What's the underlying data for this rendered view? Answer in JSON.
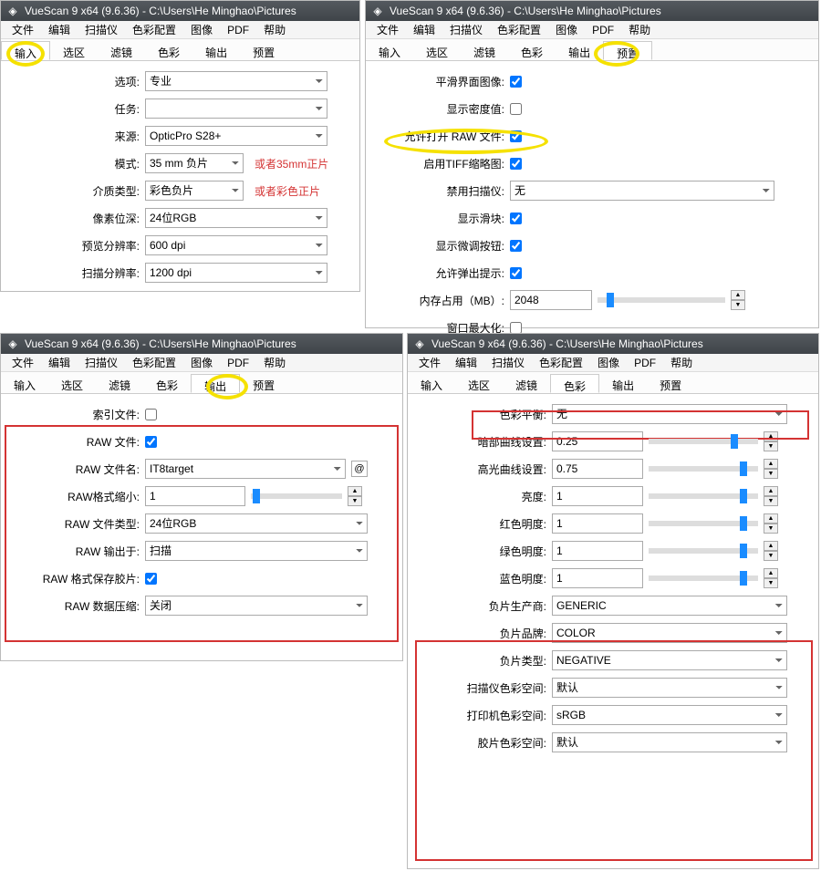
{
  "app": {
    "icon": "◈",
    "title": "VueScan 9 x64 (9.6.36) - C:\\Users\\He Minghao\\Pictures"
  },
  "menubar": [
    "文件",
    "编辑",
    "扫描仪",
    "色彩配置",
    "图像",
    "PDF",
    "帮助"
  ],
  "tabs": [
    "输入",
    "选区",
    "滤镜",
    "色彩",
    "输出",
    "预置"
  ],
  "panel1": {
    "options_lbl": "选项:",
    "options_val": "专业",
    "task_lbl": "任务:",
    "task_val": "",
    "source_lbl": "来源:",
    "source_val": "OpticPro S28+",
    "mode_lbl": "模式:",
    "mode_val": "35 mm 负片",
    "mode_anno": "或者35mm正片",
    "media_lbl": "介质类型:",
    "media_val": "彩色负片",
    "media_anno": "或者彩色正片",
    "depth_lbl": "像素位深:",
    "depth_val": "24位RGB",
    "preview_lbl": "预览分辨率:",
    "preview_val": "600 dpi",
    "scan_lbl": "扫描分辨率:",
    "scan_val": "1200 dpi"
  },
  "panel2": {
    "smooth_lbl": "平滑界面图像:",
    "density_lbl": "显示密度值:",
    "allowraw_lbl": "允许打开 RAW 文件:",
    "tiffthumb_lbl": "启用TIFF缩略图:",
    "disable_scanner_lbl": "禁用扫描仪:",
    "disable_scanner_val": "无",
    "show_slider_lbl": "显示滑块:",
    "show_fine_lbl": "显示微调按钮:",
    "allow_popup_lbl": "允许弹出提示:",
    "mem_lbl": "内存占用（MB）:",
    "mem_val": "2048",
    "maximize_lbl": "窗口最大化:"
  },
  "panel3": {
    "index_lbl": "索引文件:",
    "rawfile_lbl": "RAW 文件:",
    "rawfilename_lbl": "RAW 文件名:",
    "rawfilename_val": "IT8target",
    "rawshrink_lbl": "RAW格式缩小:",
    "rawshrink_val": "1",
    "rawtype_lbl": "RAW 文件类型:",
    "rawtype_val": "24位RGB",
    "rawout_lbl": "RAW 输出于:",
    "rawout_val": "扫描",
    "rawsave_lbl": "RAW 格式保存胶片:",
    "rawcomp_lbl": "RAW 数据压缩:",
    "rawcomp_val": "关闭",
    "at": "@"
  },
  "panel4": {
    "colorbal_lbl": "色彩平衡:",
    "colorbal_val": "无",
    "shadow_lbl": "暗部曲线设置:",
    "shadow_val": "0.25",
    "highlight_lbl": "高光曲线设置:",
    "highlight_val": "0.75",
    "brightness_lbl": "亮度:",
    "brightness_val": "1",
    "red_lbl": "红色明度:",
    "red_val": "1",
    "green_lbl": "绿色明度:",
    "green_val": "1",
    "blue_lbl": "蓝色明度:",
    "blue_val": "1",
    "vendor_lbl": "负片生产商:",
    "vendor_val": "GENERIC",
    "brand_lbl": "负片品牌:",
    "brand_val": "COLOR",
    "negtype_lbl": "负片类型:",
    "negtype_val": "NEGATIVE",
    "scannerspace_lbl": "扫描仪色彩空间:",
    "scannerspace_val": "默认",
    "printerspace_lbl": "打印机色彩空间:",
    "printerspace_val": "sRGB",
    "filmspace_lbl": "胶片色彩空间:",
    "filmspace_val": "默认"
  }
}
